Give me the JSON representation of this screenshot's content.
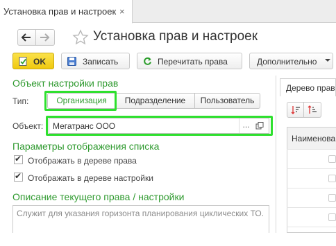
{
  "tab": {
    "title": "Установка прав и настроек",
    "close": "×"
  },
  "window": {
    "title": "Установка прав и настроек"
  },
  "toolbar": {
    "ok": "OK",
    "save": "Записать",
    "reread": "Перечитать права",
    "more": "Дополнительно"
  },
  "settings_object": {
    "heading": "Объект настройки прав",
    "type_label": "Тип:",
    "types": [
      "Организация",
      "Подразделение",
      "Пользователь"
    ],
    "selected_type": "Организация",
    "object_label": "Объект:",
    "object_value": "Мегатранс ООО",
    "object_dots": "..."
  },
  "display": {
    "heading": "Параметры отображения списка",
    "show_rights_tree": {
      "label": "Отображать в дереве права",
      "checked": true
    },
    "show_settings_tree": {
      "label": "Отображать в дереве настройки",
      "checked": true
    }
  },
  "description": {
    "heading": "Описание текущего права / настройки",
    "text": "Служит для указания горизонта планирования циклических ТО."
  },
  "right_panel": {
    "tab_label": "Дерево прав",
    "column_header": "Наименова"
  },
  "colors": {
    "accent_green": "#2ee02e",
    "section_green": "#2f9a2f",
    "ok_yellow": "#f5d31f"
  }
}
